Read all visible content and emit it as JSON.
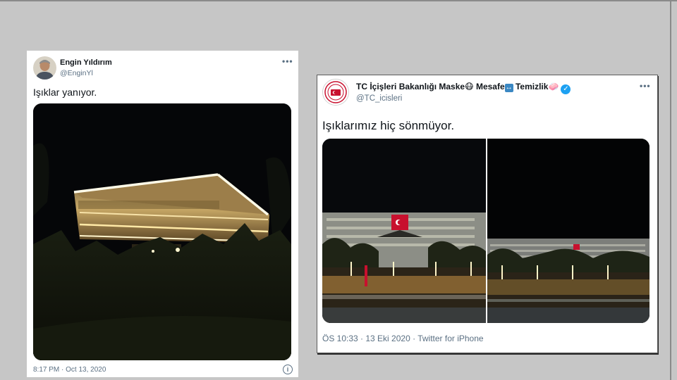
{
  "left_tweet": {
    "display_name": "Engin Yıldırım",
    "handle": "@EnginYl",
    "text": "Işıklar yanıyor.",
    "timestamp": "8:17 PM · Oct 13, 2020",
    "more_icon": "more-options-icon",
    "info_icon": "info-icon"
  },
  "right_tweet": {
    "display_name_parts": {
      "account": "TC İçişleri Bakanlığı",
      "w1": "Maske",
      "e1": "😷",
      "w2": "Mesafe",
      "e2": "↔",
      "w3": "Temizlik",
      "e3": "🧼"
    },
    "verified_glyph": "✓",
    "handle": "@TC_icisleri",
    "text": "Işıklarımız hiç sönmüyor.",
    "timestamp": "ÖS 10:33 · 13 Eki 2020 · Twitter for iPhone",
    "more_icon": "more-options-icon"
  },
  "colors": {
    "page_bg": "#c6c6c6",
    "verified": "#1da1f2",
    "secondary_text": "#5b7083",
    "primary_text": "#0f1419"
  }
}
